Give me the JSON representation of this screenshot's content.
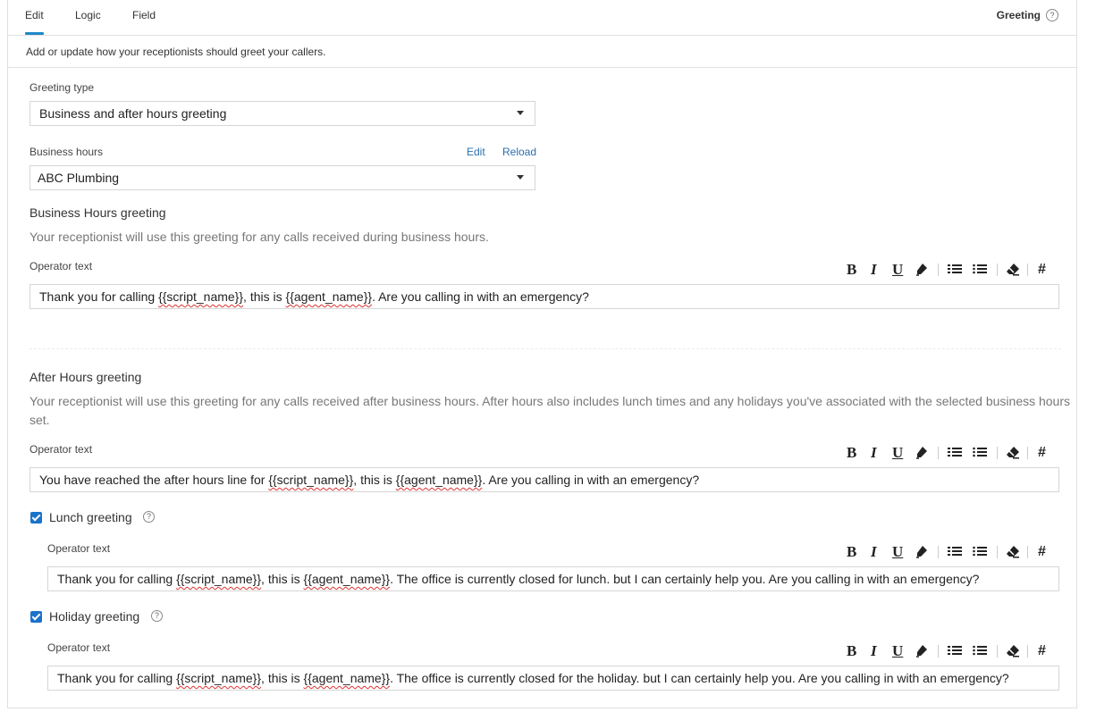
{
  "tabs": [
    {
      "label": "Edit",
      "active": true
    },
    {
      "label": "Logic",
      "active": false
    },
    {
      "label": "Field",
      "active": false
    }
  ],
  "header": {
    "title": "Greeting",
    "help_icon": "?"
  },
  "intro": "Add or update how your receptionists should greet your callers.",
  "greeting_type": {
    "label": "Greeting type",
    "value": "Business and after hours greeting"
  },
  "business_hours": {
    "label": "Business hours",
    "edit_link": "Edit",
    "reload_link": "Reload",
    "value": "ABC Plumbing"
  },
  "toolbar": {
    "bold": "B",
    "italic": "I",
    "underline": "U",
    "highlight_icon": "marker-icon",
    "ordered_list_icon": "ordered-list-icon",
    "bullet_list_icon": "bullet-list-icon",
    "clear_icon": "eraser-icon",
    "hash": "#"
  },
  "business_greeting": {
    "title": "Business Hours greeting",
    "description": "Your receptionist will use this greeting for any calls received during business hours.",
    "operator_label": "Operator text",
    "text_parts": [
      "Thank you for calling ",
      "{{script_name}}",
      ", this is ",
      "{{agent_name}}",
      ". Are you calling in with an emergency?"
    ]
  },
  "after_hours_greeting": {
    "title": "After Hours greeting",
    "description_line1": "Your receptionist will use this greeting for any calls received after business hours. After hours also includes lunch times and any holidays you've associated with the selected business hours",
    "description_line2": "set.",
    "operator_label": "Operator text",
    "text_parts": [
      "You have reached the after hours line for ",
      "{{script_name}}",
      ", this is ",
      "{{agent_name}}",
      ". Are you calling in with an emergency?"
    ]
  },
  "lunch_greeting": {
    "checked": true,
    "label": "Lunch greeting",
    "operator_label": "Operator text",
    "text_parts": [
      "Thank you for calling ",
      "{{script_name}}",
      ", this is ",
      "{{agent_name}}",
      ". The office is currently closed for lunch. but I can certainly help you. Are you calling in with an emergency?"
    ]
  },
  "holiday_greeting": {
    "checked": true,
    "label": "Holiday greeting",
    "operator_label": "Operator text",
    "text_parts": [
      "Thank you for calling ",
      "{{script_name}}",
      ", this is ",
      "{{agent_name}}",
      ". The office is currently closed for the holiday. but I can certainly help you. Are you calling in with an emergency?"
    ]
  },
  "colors": {
    "accent": "#1e88c8",
    "link": "#2a6fb0",
    "checkbox": "#1a73c9"
  }
}
